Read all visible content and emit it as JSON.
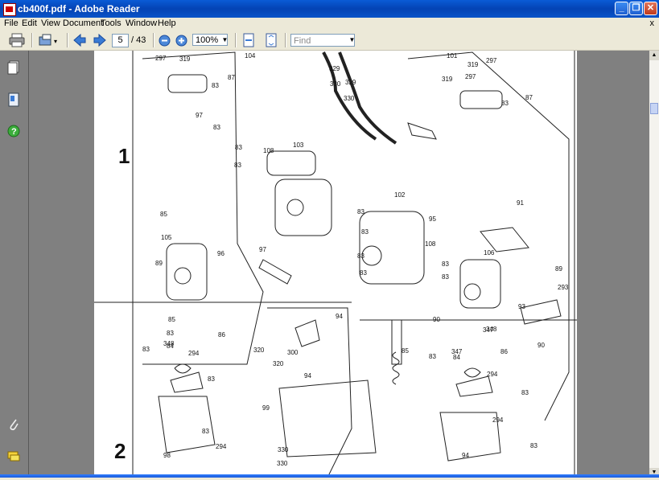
{
  "window": {
    "title": "cb400f.pdf - Adobe Reader",
    "minimize_icon": "minimize-icon",
    "maximize_icon": "maximize-icon",
    "close_icon": "close-icon"
  },
  "menu": {
    "items": [
      "File",
      "Edit",
      "View",
      "Document",
      "Tools",
      "Window",
      "Help"
    ],
    "doc_close": "x"
  },
  "toolbar": {
    "current_page": "5",
    "page_total": "/ 43",
    "zoom": "100%",
    "find_placeholder": "Find"
  },
  "diagram": {
    "section_labels": [
      "1",
      "2"
    ],
    "part_numbers": [
      "297",
      "319",
      "104",
      "87",
      "83",
      "97",
      "83",
      "83",
      "83",
      "108",
      "103",
      "85",
      "105",
      "96",
      "89",
      "97",
      "329",
      "330",
      "329",
      "330",
      "102",
      "83",
      "83",
      "83",
      "83",
      "108",
      "83",
      "83",
      "101",
      "319",
      "297",
      "319",
      "297",
      "87",
      "83",
      "95",
      "91",
      "106",
      "89",
      "293",
      "93",
      "90",
      "90",
      "347",
      "85",
      "83",
      "348",
      "83",
      "84",
      "294",
      "86",
      "83",
      "294",
      "83",
      "98",
      "320",
      "300",
      "320",
      "94",
      "94",
      "99",
      "85",
      "347",
      "348",
      "83",
      "84",
      "294",
      "86",
      "83",
      "294",
      "83",
      "94",
      "330",
      "330"
    ]
  }
}
